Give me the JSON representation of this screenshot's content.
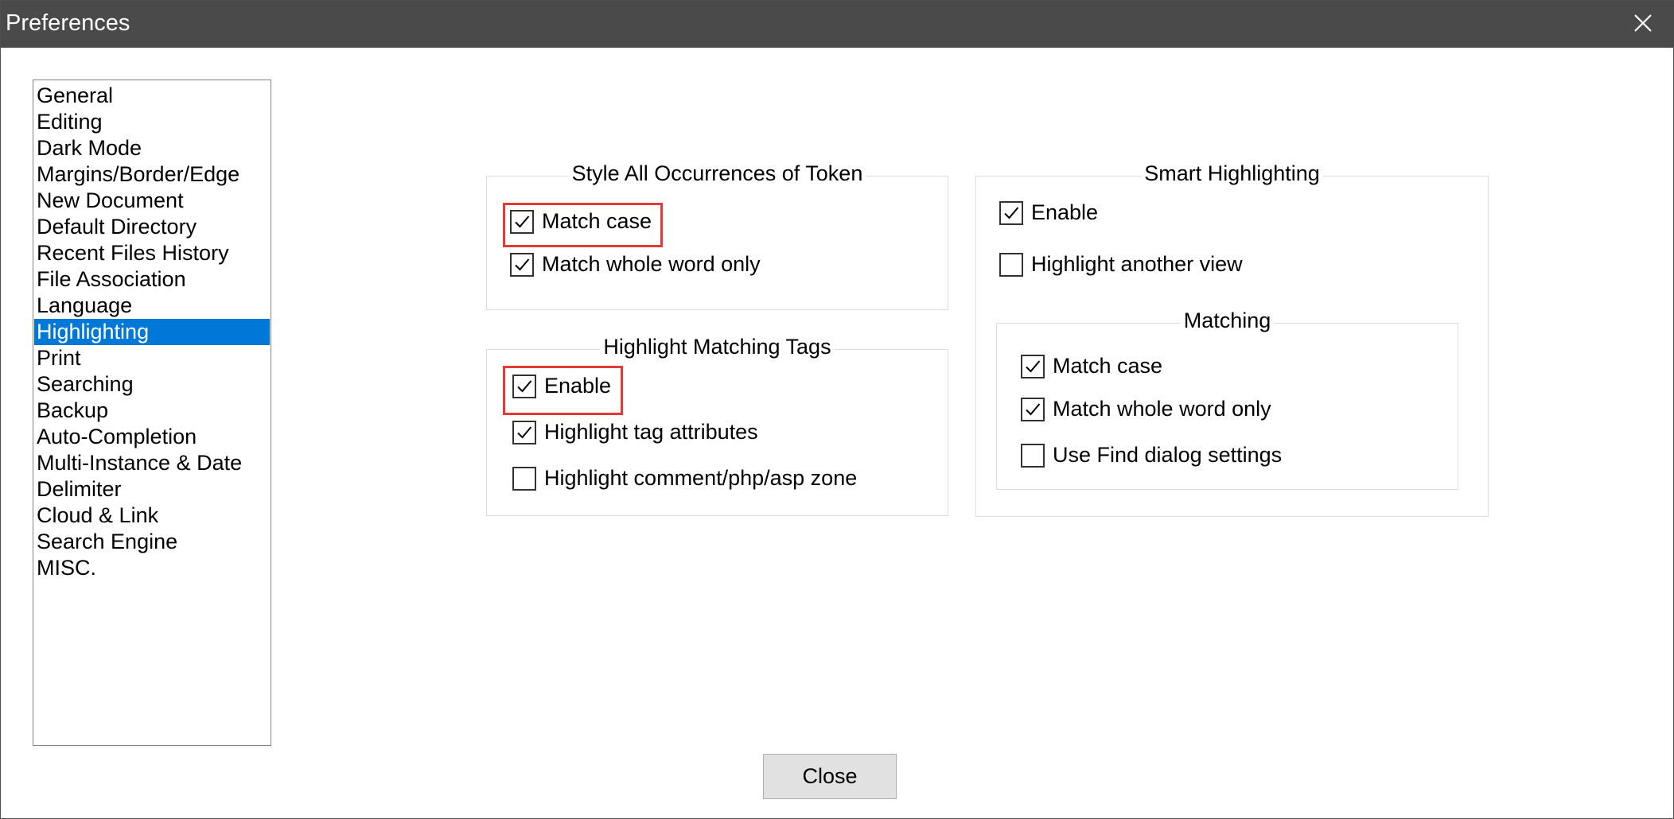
{
  "window": {
    "title": "Preferences"
  },
  "categories": [
    {
      "label": "General"
    },
    {
      "label": "Editing"
    },
    {
      "label": "Dark Mode"
    },
    {
      "label": "Margins/Border/Edge"
    },
    {
      "label": "New Document"
    },
    {
      "label": "Default Directory"
    },
    {
      "label": "Recent Files History"
    },
    {
      "label": "File Association"
    },
    {
      "label": "Language"
    },
    {
      "label": "Highlighting",
      "selected": true
    },
    {
      "label": "Print"
    },
    {
      "label": "Searching"
    },
    {
      "label": "Backup"
    },
    {
      "label": "Auto-Completion"
    },
    {
      "label": "Multi-Instance & Date"
    },
    {
      "label": "Delimiter"
    },
    {
      "label": "Cloud & Link"
    },
    {
      "label": "Search Engine"
    },
    {
      "label": "MISC."
    }
  ],
  "style_token": {
    "title": "Style All Occurrences of Token",
    "match_case": {
      "label": "Match case",
      "checked": true
    },
    "match_whole_word": {
      "label": "Match whole word only",
      "checked": true
    }
  },
  "matching_tags": {
    "title": "Highlight Matching Tags",
    "enable": {
      "label": "Enable",
      "checked": true
    },
    "tag_attributes": {
      "label": "Highlight tag attributes",
      "checked": true
    },
    "comment_zone": {
      "label": "Highlight comment/php/asp zone",
      "checked": false
    }
  },
  "smart_highlighting": {
    "title": "Smart Highlighting",
    "enable": {
      "label": "Enable",
      "checked": true
    },
    "another_view": {
      "label": "Highlight another view",
      "checked": false
    },
    "matching": {
      "title": "Matching",
      "match_case": {
        "label": "Match case",
        "checked": true
      },
      "match_whole_word": {
        "label": "Match whole word only",
        "checked": true
      },
      "use_find_settings": {
        "label": "Use Find dialog settings",
        "checked": false
      }
    }
  },
  "footer": {
    "close_label": "Close"
  },
  "colors": {
    "title_bar": "#4a4a4a",
    "selection": "#0078d7",
    "highlight_box": "#e53935"
  }
}
